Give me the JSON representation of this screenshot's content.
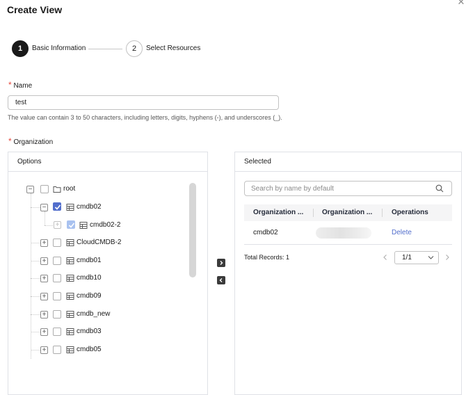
{
  "dialog": {
    "title": "Create View"
  },
  "steps": [
    {
      "number": "1",
      "label": "Basic Information"
    },
    {
      "number": "2",
      "label": "Select Resources"
    }
  ],
  "name_field": {
    "required_mark": "*",
    "label": "Name",
    "value": "test",
    "hint": "The value can contain 3 to 50 characters, including letters, digits, hyphens (-), and underscores (_)."
  },
  "organization_field": {
    "required_mark": "*",
    "label": "Organization"
  },
  "options_panel": {
    "title": "Options",
    "tree": [
      {
        "label": "root",
        "expander": "−",
        "checked": false
      },
      {
        "label": "cmdb02",
        "expander": "−",
        "checked": true
      },
      {
        "label": "cmdb02-2",
        "expander": "+",
        "checked": true
      },
      {
        "label": "CloudCMDB-2",
        "expander": "+",
        "checked": false
      },
      {
        "label": "cmdb01",
        "expander": "+",
        "checked": false
      },
      {
        "label": "cmdb10",
        "expander": "+",
        "checked": false
      },
      {
        "label": "cmdb09",
        "expander": "+",
        "checked": false
      },
      {
        "label": "cmdb_new",
        "expander": "+",
        "checked": false
      },
      {
        "label": "cmdb03",
        "expander": "+",
        "checked": false
      },
      {
        "label": "cmdb05",
        "expander": "+",
        "checked": false
      }
    ]
  },
  "selected_panel": {
    "title": "Selected",
    "search_placeholder": "Search by name by default",
    "columns": [
      "Organization ...",
      "Organization ...",
      "Operations"
    ],
    "rows": [
      {
        "name": "cmdb02",
        "operation": "Delete"
      }
    ],
    "total_records": "Total Records: 1",
    "page_select": "1/1"
  },
  "colors": {
    "accent": "#526ecc",
    "required": "#e6473c",
    "dark": "#191919"
  }
}
